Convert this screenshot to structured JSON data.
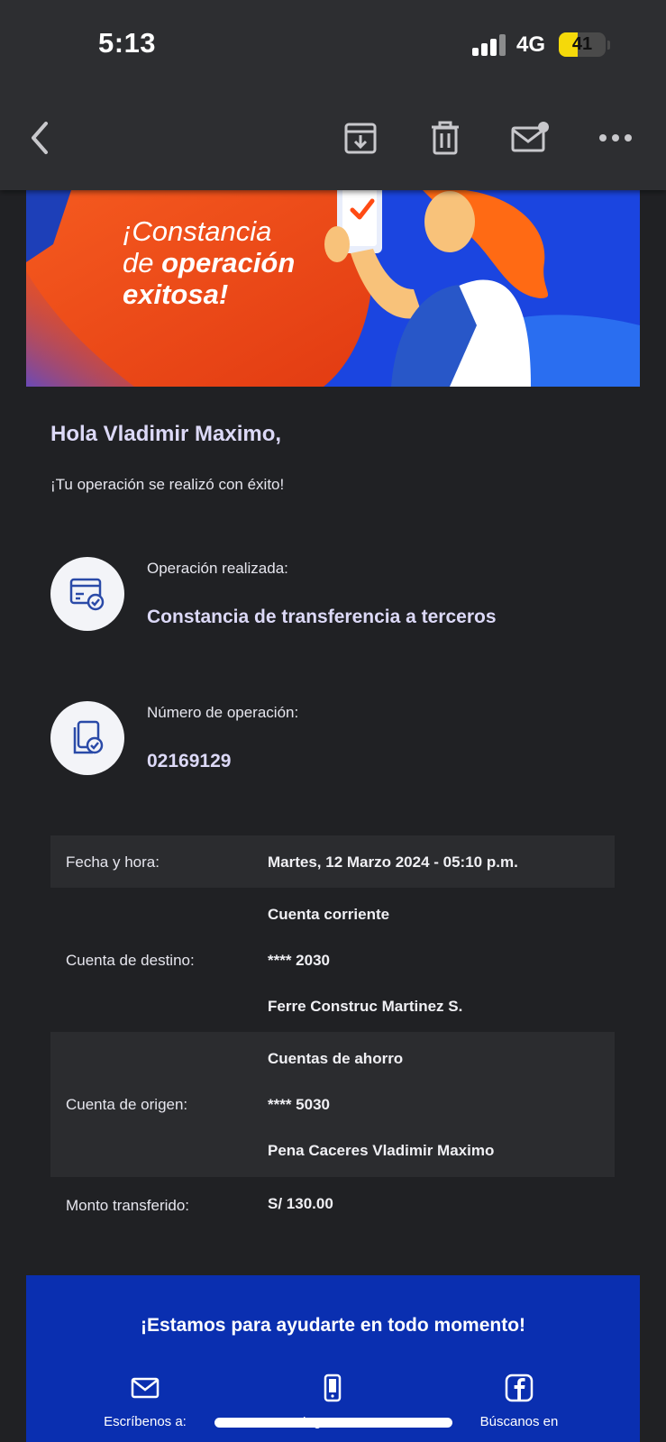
{
  "status_bar": {
    "time": "5:13",
    "network": "4G",
    "battery": "41",
    "battery_level": 0.41
  },
  "toolbar": {
    "icons": [
      "back-chevron-icon",
      "archive-icon",
      "trash-icon",
      "mark-unread-icon",
      "more-icon"
    ]
  },
  "banner": {
    "line1": "¡Constancia",
    "line2_prefix": "de ",
    "line2_bold": "operación",
    "line3": "exitosa!"
  },
  "greeting": "Hola Vladimir Maximo,",
  "subtext": "¡Tu operación se realizó con éxito!",
  "operation": {
    "label": "Operación realizada:",
    "value": "Constancia de transferencia a terceros"
  },
  "operation_number": {
    "label": "Número de operación:",
    "value": "02169129"
  },
  "details": {
    "datetime_label": "Fecha y hora:",
    "datetime_value": "Martes, 12 Marzo 2024 - 05:10 p.m.",
    "dest_label": "Cuenta de destino:",
    "dest_type": "Cuenta corriente",
    "dest_number": "**** 2030",
    "dest_name": "Ferre Construc Martinez S.",
    "origin_label": "Cuenta de origen:",
    "origin_type": "Cuentas de ahorro",
    "origin_number": "**** 5030",
    "origin_name": "Pena Caceres Vladimir Maximo",
    "amount_label": "Monto transferido:",
    "amount_value": "S/ 130.00"
  },
  "footer": {
    "title": "¡Estamos para ayudarte en todo momento!",
    "col1": "Escríbenos a:",
    "col2": "Ingresa a:",
    "col3": "Búscanos en"
  },
  "colors": {
    "background": "#202124",
    "accent_text": "#dcd9f7",
    "footer_blue": "#0a2fb0",
    "banner_orange": "#f24a1a"
  }
}
